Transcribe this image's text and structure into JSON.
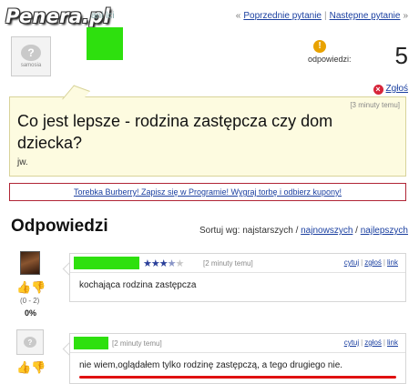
{
  "watermark": "Penera.pl",
  "top_nav": {
    "faded_link": "ani   lci",
    "prev_label": "Poprzednie pytanie",
    "next_label": "Następne pytanie"
  },
  "question_author": {
    "avatar_caption": "samosia"
  },
  "answers_count": {
    "label": "odpowiedzi:",
    "value": "5",
    "badge": "!"
  },
  "report": {
    "label": "Zgłoś"
  },
  "question": {
    "time": "[3 minuty temu]",
    "title": "Co jest lepsze - rodzina zastępcza czy dom dziecka?",
    "body": "jw."
  },
  "ad": {
    "text": "Torebka Burberry! Zapisz się w Programie! Wygraj torbę i odbierz kupony!"
  },
  "answers_section": {
    "title": "Odpowiedzi",
    "sort_prefix": "Sortuj wg: najstarszych /",
    "sort_newest": "najnowszych",
    "sort_sep": "/",
    "sort_best": "najlepszych"
  },
  "answers": [
    {
      "time": "[2 minuty temu]",
      "rating": 3.5,
      "rating_max": 5,
      "text": "kochająca rodzina zastępcza",
      "vote_range": "(0 - 2)",
      "vote_pct": "0%",
      "action_quote": "cytuj",
      "action_report": "zgłoś",
      "action_link": "link"
    },
    {
      "time": "[2 minuty temu]",
      "text": "nie wiem,oglądałem tylko rodzinę zastępczą, a tego drugiego nie.",
      "action_quote": "cytuj",
      "action_report": "zgłoś",
      "action_link": "link"
    }
  ],
  "colors": {
    "censor_green": "#2ee00e",
    "link": "#1a3fa0",
    "question_bg": "#fdfbe0",
    "ad_border": "#b02535",
    "underline_red": "#e01010"
  }
}
